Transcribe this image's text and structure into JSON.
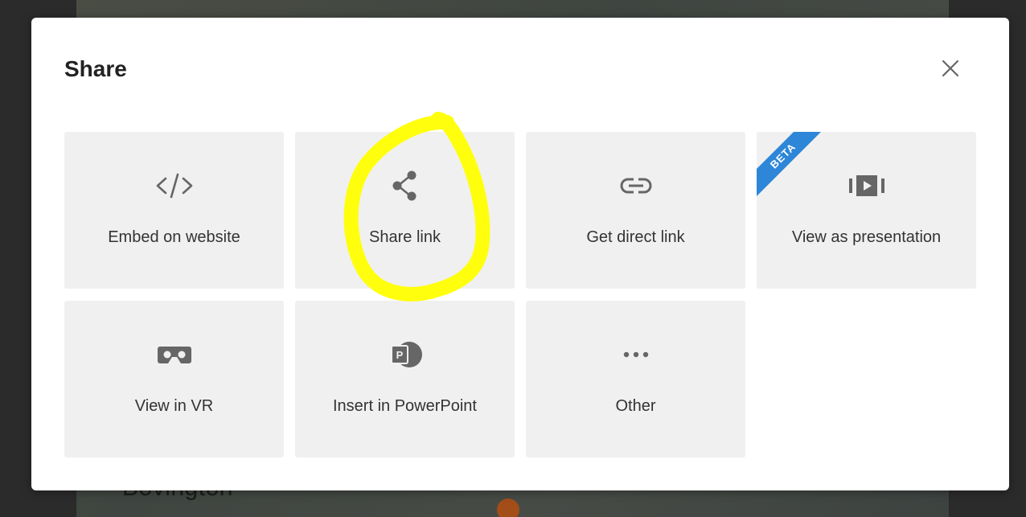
{
  "dialog": {
    "title": "Share"
  },
  "icons": {
    "close": "close-icon"
  },
  "tiles": [
    {
      "label": "Embed on website",
      "icon": "code-icon"
    },
    {
      "label": "Share link",
      "icon": "share-icon"
    },
    {
      "label": "Get direct link",
      "icon": "link-icon"
    },
    {
      "label": "View as presentation",
      "icon": "presentation-icon",
      "badge": "BETA"
    },
    {
      "label": "View in VR",
      "icon": "vr-headset-icon"
    },
    {
      "label": "Insert in PowerPoint",
      "icon": "powerpoint-icon"
    },
    {
      "label": "Other",
      "icon": "more-dots-icon"
    }
  ],
  "background": {
    "map_label": "Bovington"
  },
  "colors": {
    "tile_background": "#f0f0f0",
    "icon_gray": "#666666",
    "beta_badge": "#2d86d8",
    "highlight_annotation": "#ffff00"
  }
}
